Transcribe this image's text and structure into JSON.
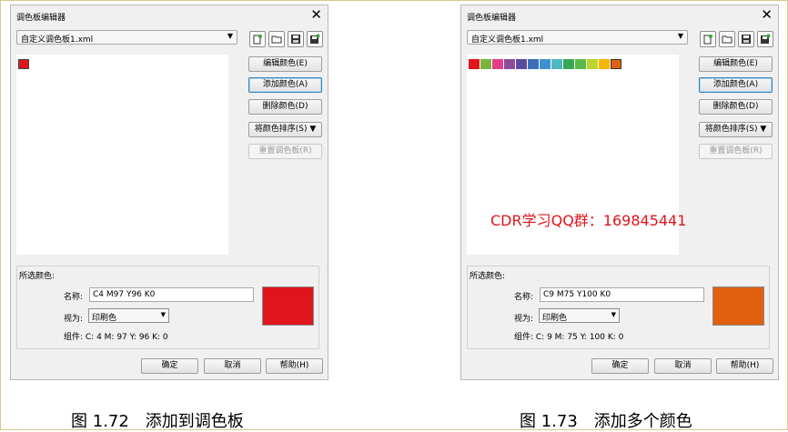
{
  "dialogs": [
    {
      "title": "调色板编辑器",
      "file": "自定义调色板1.xml",
      "swatches": [
        "#e0141c"
      ],
      "buttons": {
        "edit": "编辑颜色(E)",
        "add": "添加颜色(A)",
        "delete": "删除颜色(D)",
        "sort": "将颜色排序(S) ▼",
        "reset": "重置调色板(R)"
      },
      "selected_label": "所选颜色:",
      "name_label": "名称:",
      "name_value": "C4 M97 Y96 K0",
      "view_label": "视为:",
      "view_value": "印刷色",
      "components": "组件: C: 4 M: 97 Y: 96 K: 0",
      "preview_color": "#e0141c",
      "ok": "确定",
      "cancel": "取消",
      "help": "帮助(H)"
    },
    {
      "title": "调色板编辑器",
      "file": "自定义调色板1.xml",
      "swatches": [
        "#e0141c",
        "#7ab43c",
        "#e43d8b",
        "#8e4b9c",
        "#5b4aa0",
        "#3b6fba",
        "#3c91d1",
        "#50b7c5",
        "#35a853",
        "#59b94a",
        "#bdd42c",
        "#f2b800",
        "#e06010"
      ],
      "buttons": {
        "edit": "编辑颜色(E)",
        "add": "添加颜色(A)",
        "delete": "删除颜色(D)",
        "sort": "将颜色排序(S) ▼",
        "reset": "重置调色板(R)"
      },
      "selected_label": "所选颜色:",
      "name_label": "名称:",
      "name_value": "C9 M75 Y100 K0",
      "view_label": "视为:",
      "view_value": "印刷色",
      "components": "组件: C: 9 M: 75 Y: 100 K: 0",
      "preview_color": "#e06010",
      "ok": "确定",
      "cancel": "取消",
      "help": "帮助(H)",
      "watermark": "CDR学习QQ群：169845441"
    }
  ],
  "captions": [
    "图 1.72　添加到调色板",
    "图 1.73　添加多个颜色"
  ],
  "icons": [
    "close-icon",
    "new-palette-icon",
    "open-folder-icon",
    "save-icon",
    "save-as-icon",
    "dropdown-arrow-icon"
  ]
}
